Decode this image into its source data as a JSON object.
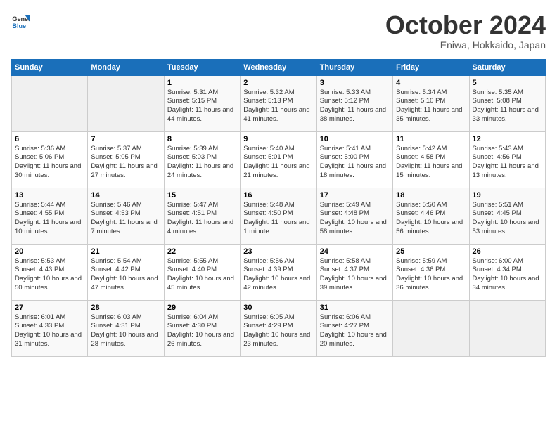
{
  "logo": {
    "line1": "General",
    "line2": "Blue"
  },
  "title": "October 2024",
  "subtitle": "Eniwa, Hokkaido, Japan",
  "days_of_week": [
    "Sunday",
    "Monday",
    "Tuesday",
    "Wednesday",
    "Thursday",
    "Friday",
    "Saturday"
  ],
  "weeks": [
    [
      {
        "day": "",
        "info": ""
      },
      {
        "day": "",
        "info": ""
      },
      {
        "day": "1",
        "info": "Sunrise: 5:31 AM\nSunset: 5:15 PM\nDaylight: 11 hours and 44 minutes."
      },
      {
        "day": "2",
        "info": "Sunrise: 5:32 AM\nSunset: 5:13 PM\nDaylight: 11 hours and 41 minutes."
      },
      {
        "day": "3",
        "info": "Sunrise: 5:33 AM\nSunset: 5:12 PM\nDaylight: 11 hours and 38 minutes."
      },
      {
        "day": "4",
        "info": "Sunrise: 5:34 AM\nSunset: 5:10 PM\nDaylight: 11 hours and 35 minutes."
      },
      {
        "day": "5",
        "info": "Sunrise: 5:35 AM\nSunset: 5:08 PM\nDaylight: 11 hours and 33 minutes."
      }
    ],
    [
      {
        "day": "6",
        "info": "Sunrise: 5:36 AM\nSunset: 5:06 PM\nDaylight: 11 hours and 30 minutes."
      },
      {
        "day": "7",
        "info": "Sunrise: 5:37 AM\nSunset: 5:05 PM\nDaylight: 11 hours and 27 minutes."
      },
      {
        "day": "8",
        "info": "Sunrise: 5:39 AM\nSunset: 5:03 PM\nDaylight: 11 hours and 24 minutes."
      },
      {
        "day": "9",
        "info": "Sunrise: 5:40 AM\nSunset: 5:01 PM\nDaylight: 11 hours and 21 minutes."
      },
      {
        "day": "10",
        "info": "Sunrise: 5:41 AM\nSunset: 5:00 PM\nDaylight: 11 hours and 18 minutes."
      },
      {
        "day": "11",
        "info": "Sunrise: 5:42 AM\nSunset: 4:58 PM\nDaylight: 11 hours and 15 minutes."
      },
      {
        "day": "12",
        "info": "Sunrise: 5:43 AM\nSunset: 4:56 PM\nDaylight: 11 hours and 13 minutes."
      }
    ],
    [
      {
        "day": "13",
        "info": "Sunrise: 5:44 AM\nSunset: 4:55 PM\nDaylight: 11 hours and 10 minutes."
      },
      {
        "day": "14",
        "info": "Sunrise: 5:46 AM\nSunset: 4:53 PM\nDaylight: 11 hours and 7 minutes."
      },
      {
        "day": "15",
        "info": "Sunrise: 5:47 AM\nSunset: 4:51 PM\nDaylight: 11 hours and 4 minutes."
      },
      {
        "day": "16",
        "info": "Sunrise: 5:48 AM\nSunset: 4:50 PM\nDaylight: 11 hours and 1 minute."
      },
      {
        "day": "17",
        "info": "Sunrise: 5:49 AM\nSunset: 4:48 PM\nDaylight: 10 hours and 58 minutes."
      },
      {
        "day": "18",
        "info": "Sunrise: 5:50 AM\nSunset: 4:46 PM\nDaylight: 10 hours and 56 minutes."
      },
      {
        "day": "19",
        "info": "Sunrise: 5:51 AM\nSunset: 4:45 PM\nDaylight: 10 hours and 53 minutes."
      }
    ],
    [
      {
        "day": "20",
        "info": "Sunrise: 5:53 AM\nSunset: 4:43 PM\nDaylight: 10 hours and 50 minutes."
      },
      {
        "day": "21",
        "info": "Sunrise: 5:54 AM\nSunset: 4:42 PM\nDaylight: 10 hours and 47 minutes."
      },
      {
        "day": "22",
        "info": "Sunrise: 5:55 AM\nSunset: 4:40 PM\nDaylight: 10 hours and 45 minutes."
      },
      {
        "day": "23",
        "info": "Sunrise: 5:56 AM\nSunset: 4:39 PM\nDaylight: 10 hours and 42 minutes."
      },
      {
        "day": "24",
        "info": "Sunrise: 5:58 AM\nSunset: 4:37 PM\nDaylight: 10 hours and 39 minutes."
      },
      {
        "day": "25",
        "info": "Sunrise: 5:59 AM\nSunset: 4:36 PM\nDaylight: 10 hours and 36 minutes."
      },
      {
        "day": "26",
        "info": "Sunrise: 6:00 AM\nSunset: 4:34 PM\nDaylight: 10 hours and 34 minutes."
      }
    ],
    [
      {
        "day": "27",
        "info": "Sunrise: 6:01 AM\nSunset: 4:33 PM\nDaylight: 10 hours and 31 minutes."
      },
      {
        "day": "28",
        "info": "Sunrise: 6:03 AM\nSunset: 4:31 PM\nDaylight: 10 hours and 28 minutes."
      },
      {
        "day": "29",
        "info": "Sunrise: 6:04 AM\nSunset: 4:30 PM\nDaylight: 10 hours and 26 minutes."
      },
      {
        "day": "30",
        "info": "Sunrise: 6:05 AM\nSunset: 4:29 PM\nDaylight: 10 hours and 23 minutes."
      },
      {
        "day": "31",
        "info": "Sunrise: 6:06 AM\nSunset: 4:27 PM\nDaylight: 10 hours and 20 minutes."
      },
      {
        "day": "",
        "info": ""
      },
      {
        "day": "",
        "info": ""
      }
    ]
  ]
}
